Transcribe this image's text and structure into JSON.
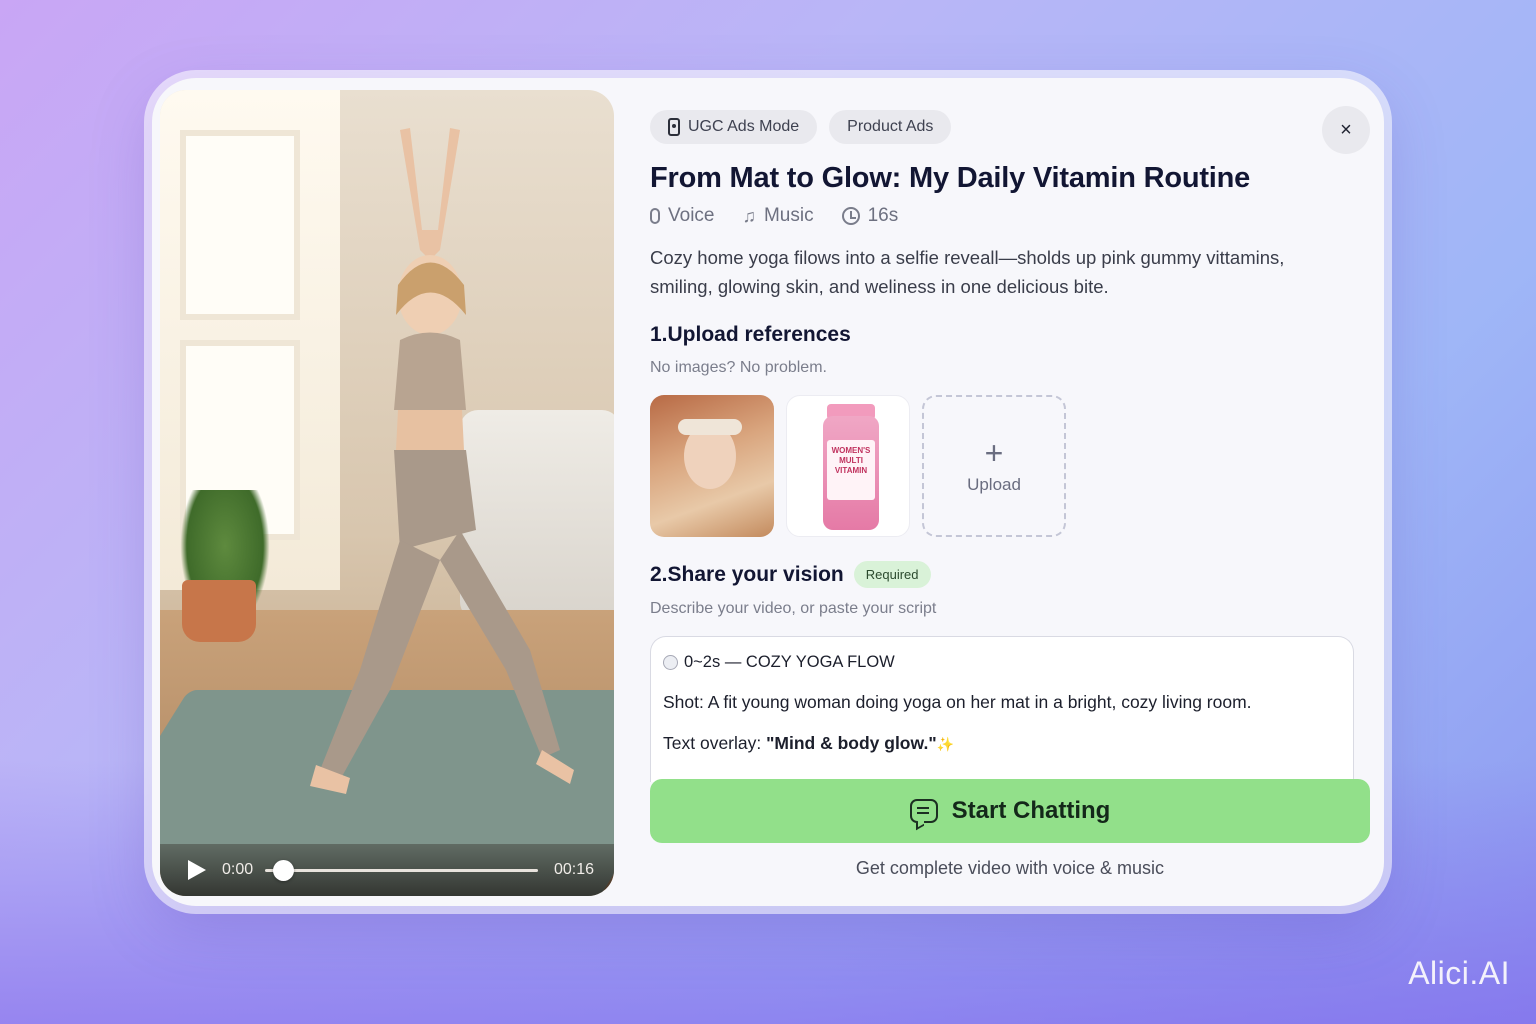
{
  "video": {
    "current_time": "0:00",
    "duration": "00:16",
    "progress": 0.03
  },
  "chips": {
    "ugc_mode": "UGC Ads Mode",
    "product_ads": "Product Ads"
  },
  "close_label": "×",
  "title": "From Mat to Glow: My Daily Vitamin Routine",
  "meta": {
    "voice": "Voice",
    "music": "Music",
    "duration": "16s"
  },
  "description": "Cozy home yoga filows into a selfie reveall—sholds up pink gummy vittamins, smiling, glowing skin, and weliness in one delicious bite.",
  "upload_section": {
    "heading": "1.Upload references",
    "subtext": "No images? No problem.",
    "upload_label": "Upload",
    "upload_plus": "+",
    "bottle_label": "WOMEN'S MULTI VITAMIN"
  },
  "vision_section": {
    "heading": "2.Share your vision",
    "badge": "Required",
    "subtext": "Describe your video, or paste your script",
    "scene_title": "0~2s — COZY YOGA FLOW",
    "shot": "Shot: A fit young woman doing yoga on her mat in a bright, cozy living room.",
    "overlay_prefix": "Text overlay: ",
    "overlay_text": "\"Mind & body glow.\"",
    "overlay_emoji": "✨"
  },
  "cta": {
    "label": "Start Chatting"
  },
  "footnote": "Get complete video with voice & music",
  "brand": "Alici.AI",
  "colors": {
    "cta_green": "#92e08a",
    "badge_green": "#d9f2d8",
    "title_navy": "#121633"
  },
  "icons": [
    "play-icon",
    "phone-icon",
    "close-icon",
    "mic-icon",
    "music-note-icon",
    "clock-icon",
    "plus-icon",
    "chat-icon",
    "sparkle-icon"
  ]
}
